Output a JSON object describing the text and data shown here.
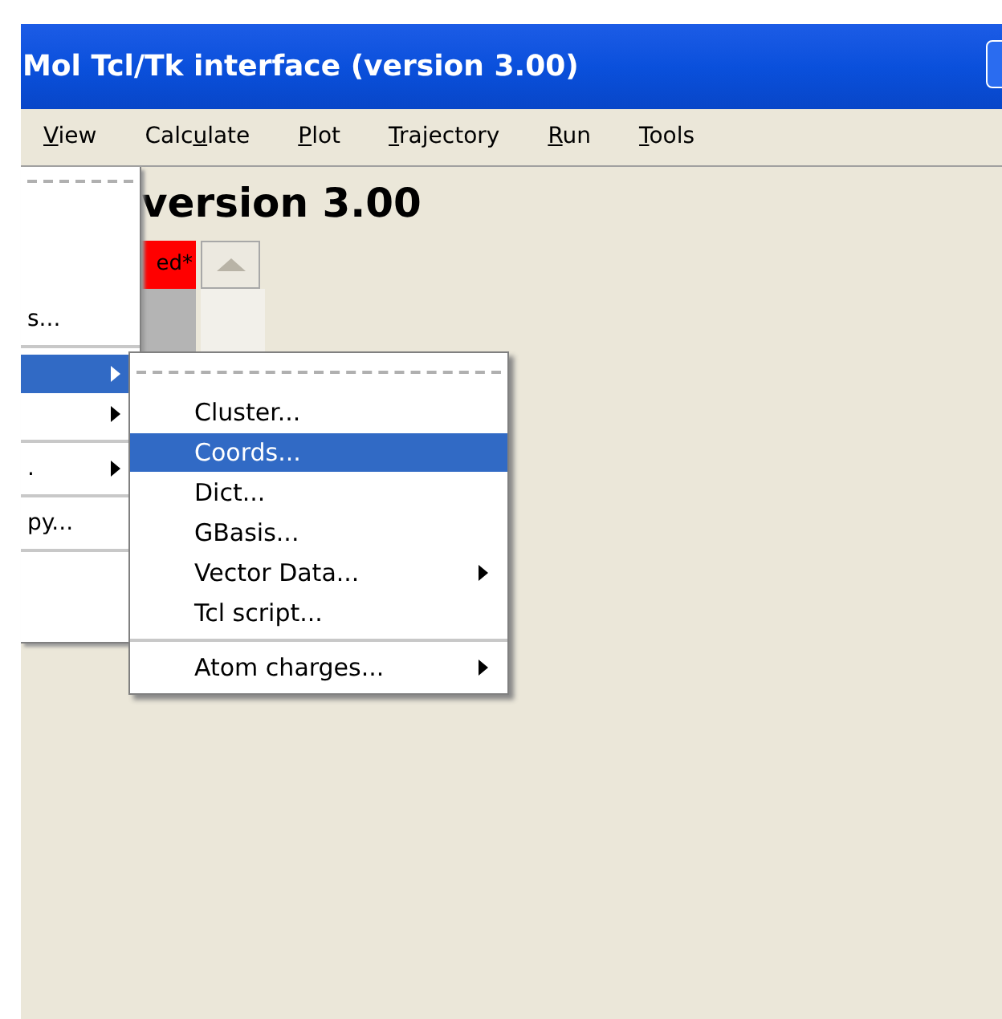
{
  "window": {
    "title": "Mol Tcl/Tk interface (version 3.00)"
  },
  "menu_bar": [
    {
      "key": "V",
      "after": "iew"
    },
    {
      "before": "Calc",
      "key": "u",
      "after": "late"
    },
    {
      "key": "P",
      "after": "lot"
    },
    {
      "key": "T",
      "after": "rajectory"
    },
    {
      "key": "R",
      "after": "un"
    },
    {
      "key": "T",
      "after": "ools"
    }
  ],
  "heading": "version 3.00",
  "status_field": {
    "value": "ed*"
  },
  "menu": [
    {
      "kind": "tearoff"
    },
    {
      "kind": "item",
      "label": "s...",
      "selected": false
    },
    {
      "kind": "separator"
    },
    {
      "kind": "cascade",
      "selected": true
    },
    {
      "kind": "cascade",
      "selected": false
    },
    {
      "kind": "separator"
    },
    {
      "kind": "cascade",
      "label": ".",
      "selected": false
    },
    {
      "kind": "separator"
    },
    {
      "kind": "item",
      "label": "py...",
      "selected": false
    },
    {
      "kind": "separator"
    }
  ],
  "submenu": [
    {
      "kind": "tearoff"
    },
    {
      "kind": "item",
      "label": "Cluster...",
      "selected": false
    },
    {
      "kind": "item",
      "label": "Coords...",
      "selected": true
    },
    {
      "kind": "item",
      "label": "Dict...",
      "selected": false
    },
    {
      "kind": "item",
      "label": "GBasis...",
      "selected": false
    },
    {
      "kind": "cascade",
      "label": "Vector Data...",
      "selected": false
    },
    {
      "kind": "item",
      "label": "Tcl script...",
      "selected": false
    },
    {
      "kind": "separator"
    },
    {
      "kind": "cascade",
      "label": "Atom charges...",
      "selected": false
    }
  ]
}
